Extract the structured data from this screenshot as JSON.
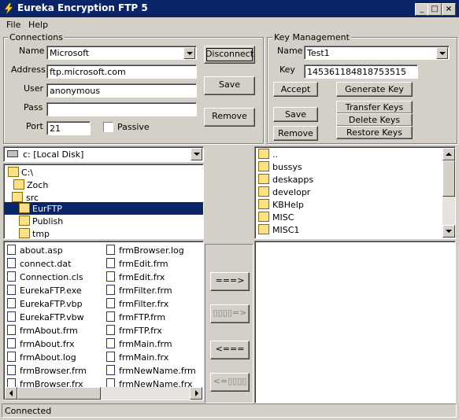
{
  "window": {
    "title": "Eureka Encryption FTP 5",
    "minimize": "_",
    "maximize": "□",
    "close": "×"
  },
  "menu": [
    "File",
    "Help"
  ],
  "connections": {
    "title": "Connections",
    "name_label": "Name",
    "name_value": "Microsoft",
    "address_label": "Address",
    "address_value": "ftp.microsoft.com",
    "user_label": "User",
    "user_value": "anonymous",
    "pass_label": "Pass",
    "pass_value": "",
    "port_label": "Port",
    "port_value": "21",
    "passive_label": "Passive",
    "passive_checked": false,
    "disconnect_label": "Disconnect",
    "save_label": "Save",
    "remove_label": "Remove"
  },
  "keys": {
    "title": "Key Management",
    "name_label": "Name",
    "name_value": "Test1",
    "key_label": "Key",
    "key_value": "145361184818753515",
    "accept_label": "Accept",
    "generate_label": "Generate Key",
    "save_label": "Save",
    "transfer_label": "Transfer Keys",
    "delete_label": "Delete Keys",
    "remove_label": "Remove",
    "restore_label": "Restore Keys"
  },
  "local": {
    "drive": "c: [Local Disk]",
    "folders": [
      "C:\\",
      "Zoch",
      "src",
      "EurFTP",
      "Publish",
      "tmp"
    ],
    "selected_folder": "EurFTP",
    "files_col1": [
      "about.asp",
      "connect.dat",
      "Connection.cls",
      "EurekaFTP.exe",
      "EurekaFTP.vbp",
      "EurekaFTP.vbw",
      "frmAbout.frm",
      "frmAbout.frx",
      "frmAbout.log",
      "frmBrowser.frm",
      "frmBrowser.frx"
    ],
    "files_col2": [
      "frmBrowser.log",
      "frmEdit.frm",
      "frmEdit.frx",
      "frmFilter.frm",
      "frmFilter.frx",
      "frmFTP.frm",
      "frmFTP.frx",
      "frmMain.frm",
      "frmMain.frx",
      "frmNewName.frm",
      "frmNewName.frx"
    ]
  },
  "transfer": {
    "upload": "===>",
    "upload_encrypted": "▯▯▯▯=>",
    "download": "<===",
    "download_encrypted": "<=▯▯▯▯"
  },
  "remote": {
    "folders": [
      "..",
      "bussys",
      "deskapps",
      "developr",
      "KBHelp",
      "MISC",
      "MISC1"
    ],
    "files": []
  },
  "status": "Connected"
}
